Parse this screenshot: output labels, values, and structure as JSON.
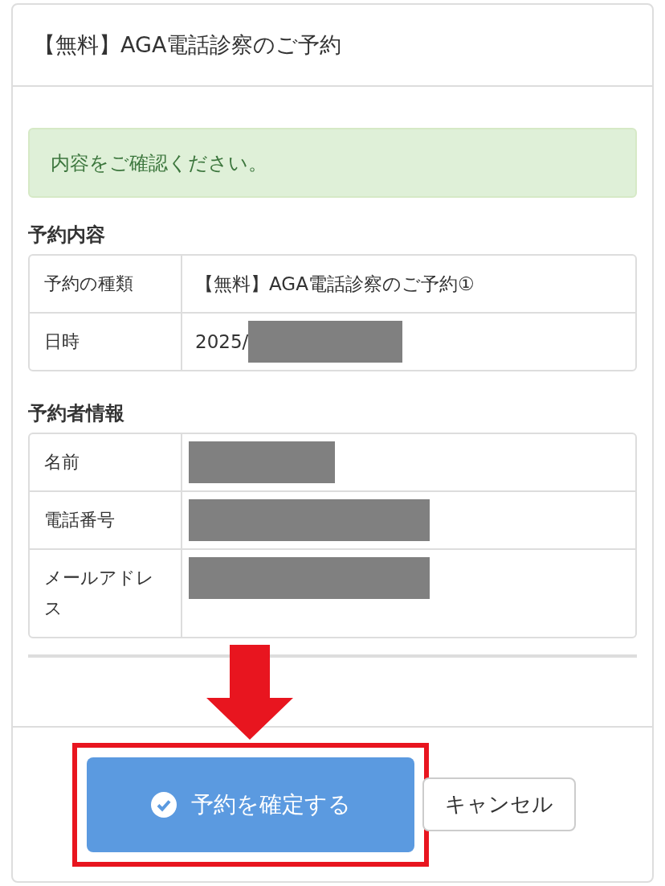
{
  "dialog": {
    "title": "【無料】AGA電話診察のご予約"
  },
  "alert": {
    "message": "内容をご確認ください。"
  },
  "sections": [
    {
      "heading": "予約内容",
      "rows": [
        {
          "label": "予約の種類",
          "value": "【無料】AGA電話診察のご予約①"
        },
        {
          "label": "日時",
          "value": "2025/",
          "redacted": true
        }
      ]
    },
    {
      "heading": "予約者情報",
      "rows": [
        {
          "label": "名前",
          "redacted": true
        },
        {
          "label": "電話番号",
          "redacted": true
        },
        {
          "label": "メールアドレス",
          "redacted": true
        }
      ]
    }
  ],
  "buttons": [
    {
      "kind": "primary",
      "label": "予約を確定する",
      "highlighted": true
    },
    {
      "kind": "secondary",
      "label": "キャンセル",
      "highlighted": false
    }
  ]
}
